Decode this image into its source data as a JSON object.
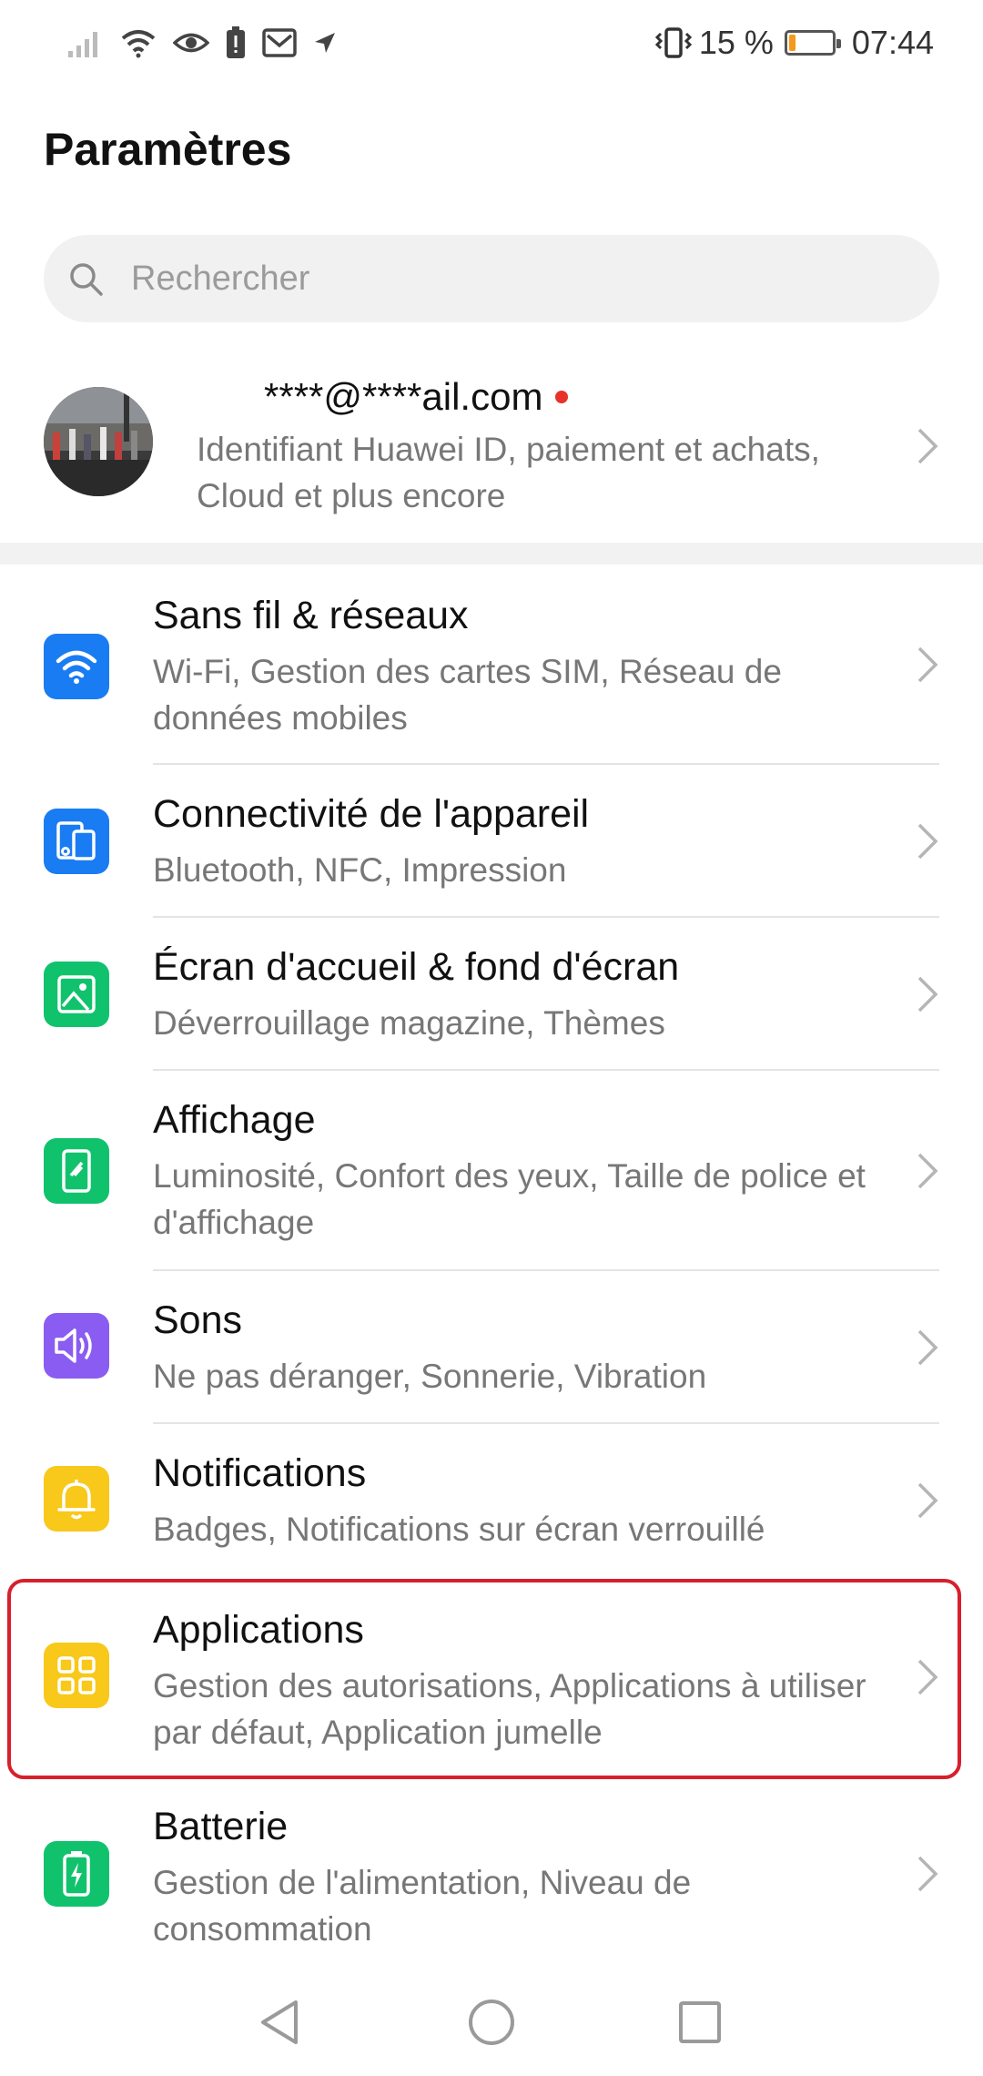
{
  "status_bar": {
    "battery_percent": "15 %",
    "battery_level": 0.15,
    "time": "07:44",
    "icons": [
      "signal-icon",
      "wifi-icon",
      "eye-icon",
      "battery-alert-icon",
      "mail-icon",
      "navigation-icon",
      "vibrate-icon"
    ]
  },
  "page_title": "Paramètres",
  "search": {
    "placeholder": "Rechercher"
  },
  "account": {
    "email": "****@****ail.com",
    "description": "Identifiant Huawei ID, paiement et achats, Cloud et plus encore"
  },
  "settings": [
    {
      "title": "Sans fil & réseaux",
      "subtitle": "Wi-Fi, Gestion des cartes SIM, Réseau de données mobiles",
      "icon": "wifi-icon",
      "color": "#1a7cf2"
    },
    {
      "title": "Connectivité de l'appareil",
      "subtitle": "Bluetooth, NFC, Impression",
      "icon": "device-connectivity-icon",
      "color": "#1a7cf2"
    },
    {
      "title": "Écran d'accueil & fond d'écran",
      "subtitle": "Déverrouillage magazine, Thèmes",
      "icon": "wallpaper-icon",
      "color": "#11c26d"
    },
    {
      "title": "Affichage",
      "subtitle": "Luminosité, Confort des yeux, Taille de police et d'affichage",
      "icon": "display-icon",
      "color": "#11c26d"
    },
    {
      "title": "Sons",
      "subtitle": "Ne pas déranger, Sonnerie, Vibration",
      "icon": "sound-icon",
      "color": "#8a5cf2"
    },
    {
      "title": "Notifications",
      "subtitle": "Badges, Notifications sur écran verrouillé",
      "icon": "bell-icon",
      "color": "#f8c81b"
    },
    {
      "title": "Applications",
      "subtitle": "Gestion des autorisations, Applications à utiliser par défaut, Application jumelle",
      "icon": "apps-grid-icon",
      "color": "#f8c81b"
    },
    {
      "title": "Batterie",
      "subtitle": "Gestion de l'alimentation, Niveau de consommation",
      "icon": "battery-icon",
      "color": "#11c26d"
    }
  ],
  "highlight_color": "#d81f2c",
  "nav": [
    "back-icon",
    "home-icon",
    "recents-icon"
  ]
}
